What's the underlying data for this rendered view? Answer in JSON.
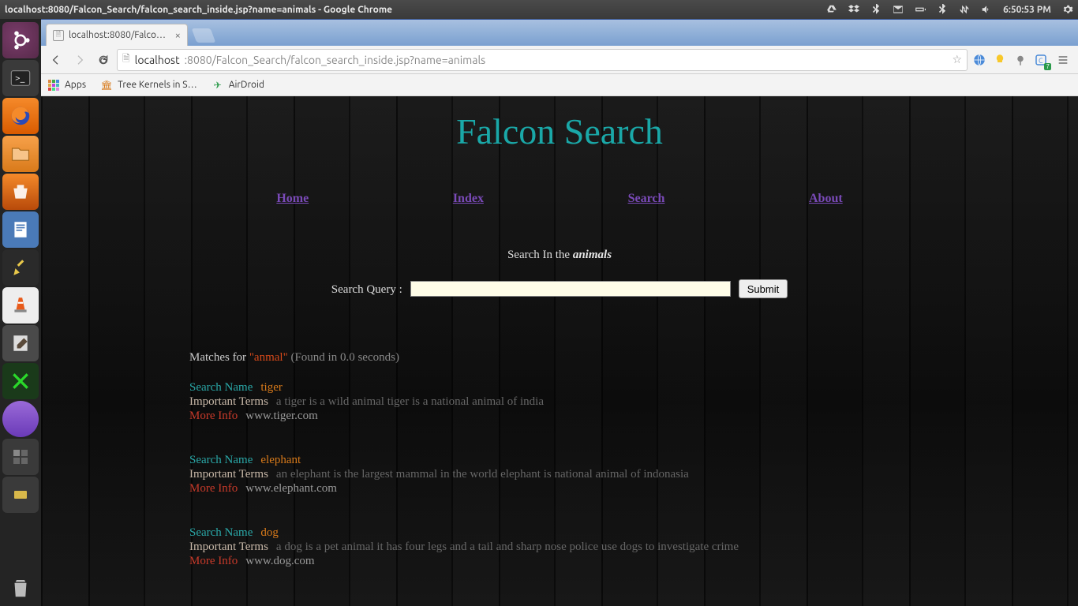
{
  "system": {
    "window_title": "localhost:8080/Falcon_Search/falcon_search_inside.jsp?name=animals - Google Chrome",
    "clock": "6:50:53 PM"
  },
  "browser": {
    "tab_title": "localhost:8080/Falcon_Se",
    "url_host": "localhost",
    "url_path": ":8080/Falcon_Search/falcon_search_inside.jsp?name=animals",
    "bookmarks": {
      "apps": "Apps",
      "tree": "Tree Kernels in S…",
      "airdroid": "AirDroid"
    }
  },
  "page": {
    "title": "Falcon Search",
    "nav": {
      "home": "Home",
      "index": "Index",
      "search": "Search",
      "about": "About"
    },
    "search_in_prefix": "Search In the ",
    "search_category": "animals",
    "query_label": "Search Query :",
    "submit": "Submit",
    "matches_prefix": "Matches for ",
    "query_echo": "\"anmal\"",
    "timing": " (Found in 0.0 seconds)",
    "labels": {
      "name": "Search Name",
      "terms": "Important Terms",
      "more": "More Info"
    },
    "results": [
      {
        "name": "tiger",
        "terms": "a tiger is a wild animal tiger is a national animal of india",
        "url": "www.tiger.com"
      },
      {
        "name": "elephant",
        "terms": "an elephant is the largest mammal in the world elephant is national animal of indonasia",
        "url": "www.elephant.com"
      },
      {
        "name": "dog",
        "terms": "a dog is a pet animal it has four legs and a tail and sharp nose police use dogs to investigate crime",
        "url": "www.dog.com"
      }
    ]
  }
}
